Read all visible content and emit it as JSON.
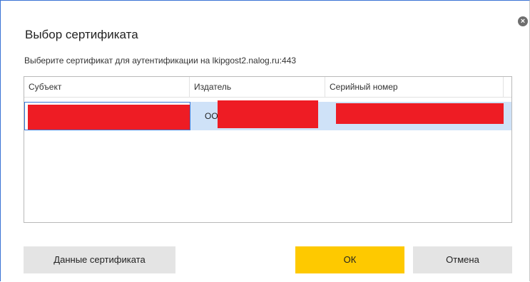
{
  "dialog": {
    "title": "Выбор сертификата",
    "subtitle": "Выберите сертификат для аутентификации на lkipgost2.nalog.ru:443",
    "close_symbol": "×"
  },
  "table": {
    "columns": [
      "Субъект",
      "Издатель",
      "Серийный номер"
    ],
    "rows": [
      {
        "subject": "",
        "issuer": "ООО",
        "serial": "",
        "selected": true,
        "redacted": true
      }
    ]
  },
  "buttons": {
    "details_label": "Данные сертификата",
    "ok_label": "ОК",
    "cancel_label": "Отмена"
  },
  "colors": {
    "accent_border": "#3b73d4",
    "selection": "#cfe2f8",
    "primary_button": "#fec900",
    "secondary_button": "#e4e4e4",
    "redaction": "#ee1c24"
  },
  "icons": {
    "close": "close-icon"
  }
}
